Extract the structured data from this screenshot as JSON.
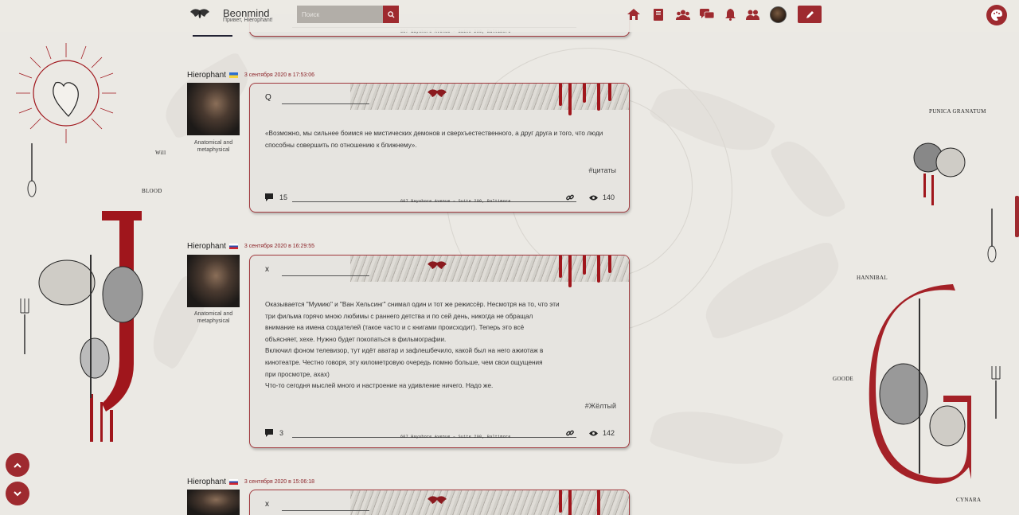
{
  "header": {
    "brand": "Beonmind",
    "greeting": "Привет, Hierophant!",
    "search_placeholder": "Поиск",
    "nav_icons": [
      "home-icon",
      "notes-icon",
      "users-icon",
      "chat-icon",
      "bell-icon",
      "friends-icon",
      "avatar",
      "write-icon"
    ],
    "accent": "#9e2a2f"
  },
  "posts": [
    {
      "author": "Hierophant",
      "flag": "ua",
      "date": "3 сентября 2020 в 17:53:06",
      "status": "Anatomical and metaphysical",
      "title": "Q",
      "text": [
        "«Возможно, мы сильнее боимся не мистических демонов и сверхъестественного, а друг друга и того, что люди способны совершить по отношению к ближнему»."
      ],
      "tag": "#цитаты",
      "comments": "15",
      "views": "140",
      "address": "607 Bayshore Avenue – Suite 200, Baltimore"
    },
    {
      "author": "Hierophant",
      "flag": "ru",
      "date": "3 сентября 2020 в 16:29:55",
      "status": "Anatomical and metaphysical",
      "title": "x",
      "text": [
        "Оказывается \"Мумию\" и \"Ван Хельсинг\" снимал один и тот же режиссёр. Несмотря на то, что эти",
        "три фильма горячо мною любимы с раннего детства и по сей день, никогда не обращал",
        "внимание на имена создателей (такое часто и с книгами происходит). Теперь это всё",
        "объясняет, хехе. Нужно будет покопаться в фильмографии.",
        "Включил фоном телевизор, тут идёт аватар и зафлешбечило, какой был на него ажиотаж в",
        "кинотеатре. Честно говоря, эту километровую очередь помню больше, чем свои ощущения",
        "при просмотре, ахах)",
        "Что-то сегодня мыслей много и настроение на удивление ничего. Надо же."
      ],
      "tag": "#Жёлтый",
      "comments": "3",
      "views": "142",
      "address": "607 Bayshore Avenue – Suite 200, Baltimore"
    },
    {
      "author": "Hierophant",
      "flag": "ru",
      "date": "3 сентября 2020 в 15:06:18",
      "title": "x"
    }
  ],
  "prev_post_address": "607 Bayshore Avenue – Suite 200, Baltimore",
  "decor_labels": {
    "left": [
      "Will",
      "BLOOD"
    ],
    "right": [
      "PUNICA GRANATUM",
      "HANNIBAL",
      "GOODE",
      "CYNARA"
    ]
  }
}
